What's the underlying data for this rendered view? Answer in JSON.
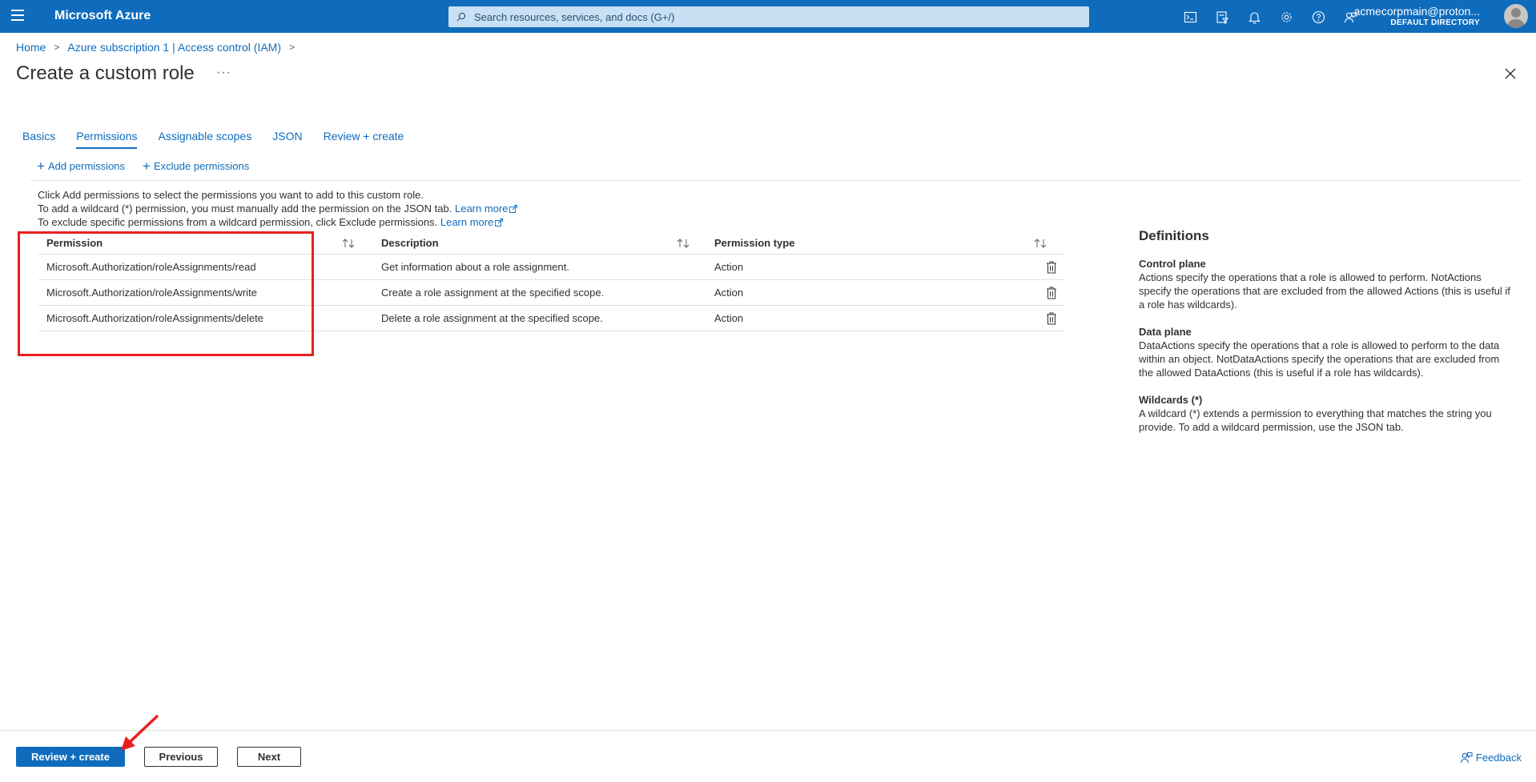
{
  "topbar": {
    "brand": "Microsoft Azure",
    "search_placeholder": "Search resources, services, and docs (G+/)",
    "account_name": "acmecorpmain@proton...",
    "account_directory": "DEFAULT DIRECTORY",
    "color": "#0f6cbd"
  },
  "breadcrumb": {
    "items": [
      "Home",
      "Azure subscription 1 | Access control (IAM)"
    ]
  },
  "page": {
    "title": "Create a custom role",
    "more": "···"
  },
  "tabs": [
    "Basics",
    "Permissions",
    "Assignable scopes",
    "JSON",
    "Review + create"
  ],
  "active_tab": "Permissions",
  "commands": {
    "add": "Add permissions",
    "exclude": "Exclude permissions"
  },
  "info": {
    "line1": "Click Add permissions to select the permissions you want to add to this custom role.",
    "line2": "To add a wildcard (*) permission, you must manually add the permission on the JSON tab.",
    "line3": "To exclude specific permissions from a wildcard permission, click Exclude permissions.",
    "learn_more": "Learn more"
  },
  "table": {
    "headers": [
      "Permission",
      "Description",
      "Permission type"
    ],
    "rows": [
      {
        "permission": "Microsoft.Authorization/roleAssignments/read",
        "description": "Get information about a role assignment.",
        "type": "Action"
      },
      {
        "permission": "Microsoft.Authorization/roleAssignments/write",
        "description": "Create a role assignment at the specified scope.",
        "type": "Action"
      },
      {
        "permission": "Microsoft.Authorization/roleAssignments/delete",
        "description": "Delete a role assignment at the specified scope.",
        "type": "Action"
      }
    ]
  },
  "definitions": {
    "title": "Definitions",
    "sections": [
      {
        "heading": "Control plane",
        "text": "Actions specify the operations that a role is allowed to perform. NotActions specify the operations that are excluded from the allowed Actions (this is useful if a role has wildcards)."
      },
      {
        "heading": "Data plane",
        "text": "DataActions specify the operations that a role is allowed to perform to the data within an object. NotDataActions specify the operations that are excluded from the allowed DataActions (this is useful if a role has wildcards)."
      },
      {
        "heading": "Wildcards (*)",
        "text": "A wildcard (*) extends a permission to everything that matches the string you provide. To add a wildcard permission, use the JSON tab."
      }
    ]
  },
  "footer": {
    "review_create": "Review + create",
    "previous": "Previous",
    "next": "Next",
    "feedback": "Feedback"
  },
  "annotation_color": "#e8201e"
}
